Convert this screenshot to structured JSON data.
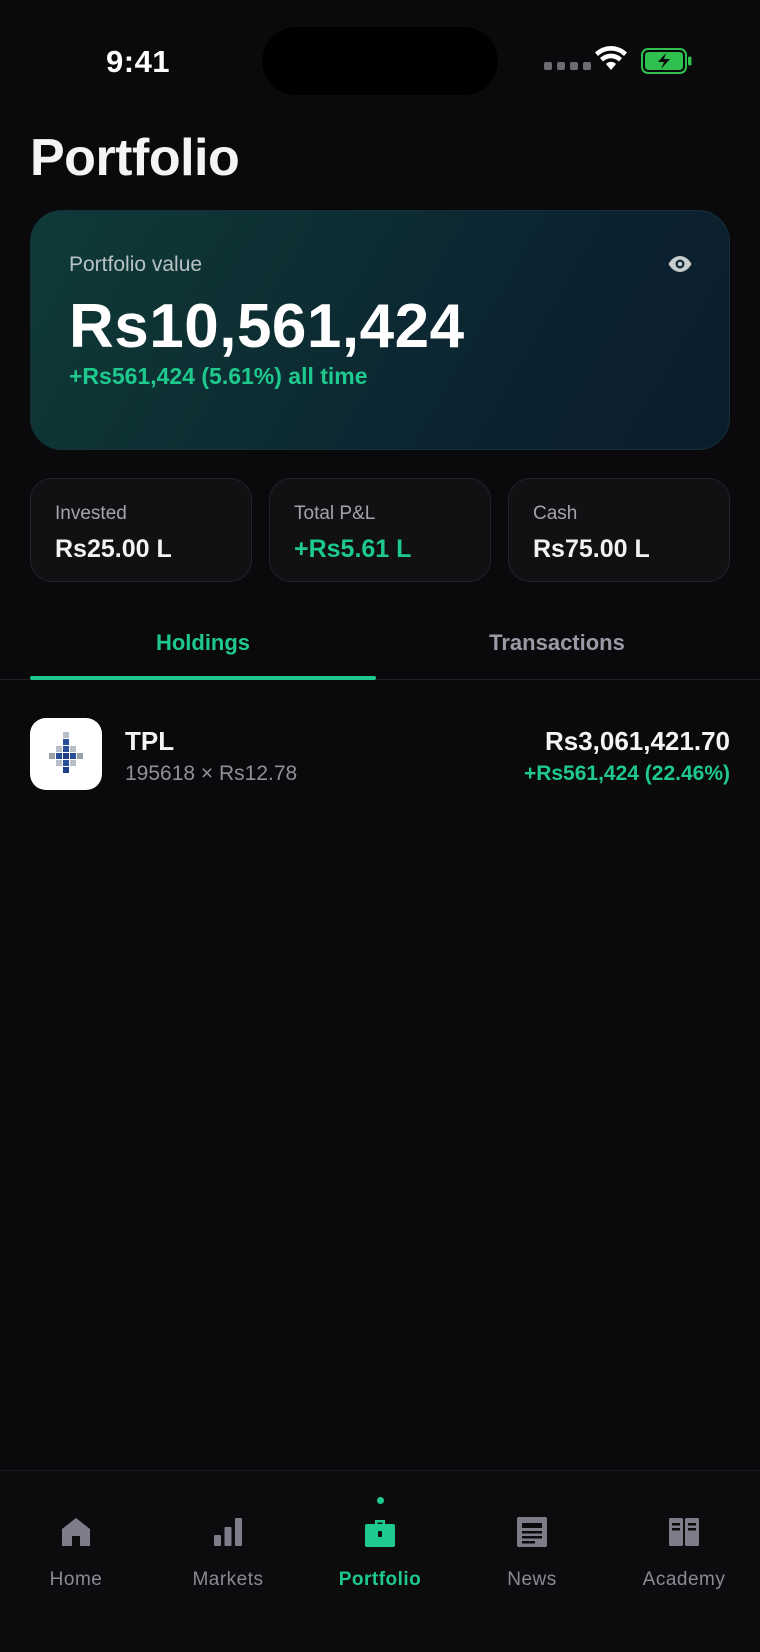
{
  "status_bar": {
    "time": "9:41"
  },
  "page": {
    "title": "Portfolio"
  },
  "hero": {
    "label": "Portfolio value",
    "value": "Rs10,561,424",
    "change": "+Rs561,424 (5.61%) all time",
    "visibility_icon": "eye-icon"
  },
  "stats": [
    {
      "label": "Invested",
      "value": "Rs25.00 L"
    },
    {
      "label": "Total P&L",
      "value": "+Rs5.61 L"
    },
    {
      "label": "Cash",
      "value": "Rs75.00 L"
    }
  ],
  "tabs": [
    {
      "label": "Holdings",
      "active": true
    },
    {
      "label": "Transactions",
      "active": false
    }
  ],
  "holdings": [
    {
      "symbol": "TPL",
      "quantity_price": "195618 × Rs12.78",
      "value": "Rs3,061,421.70",
      "change": "+Rs561,424 (22.46%)"
    }
  ],
  "nav": {
    "items": [
      {
        "label": "Home",
        "icon": "home-icon"
      },
      {
        "label": "Markets",
        "icon": "bar-chart-icon"
      },
      {
        "label": "Portfolio",
        "icon": "briefcase-icon",
        "active": true
      },
      {
        "label": "News",
        "icon": "newspaper-icon"
      },
      {
        "label": "Academy",
        "icon": "book-icon"
      }
    ]
  },
  "colors": {
    "accent": "#1ec98e",
    "background": "#0a0a0c",
    "card": "#111114",
    "muted": "#8a8a96"
  }
}
